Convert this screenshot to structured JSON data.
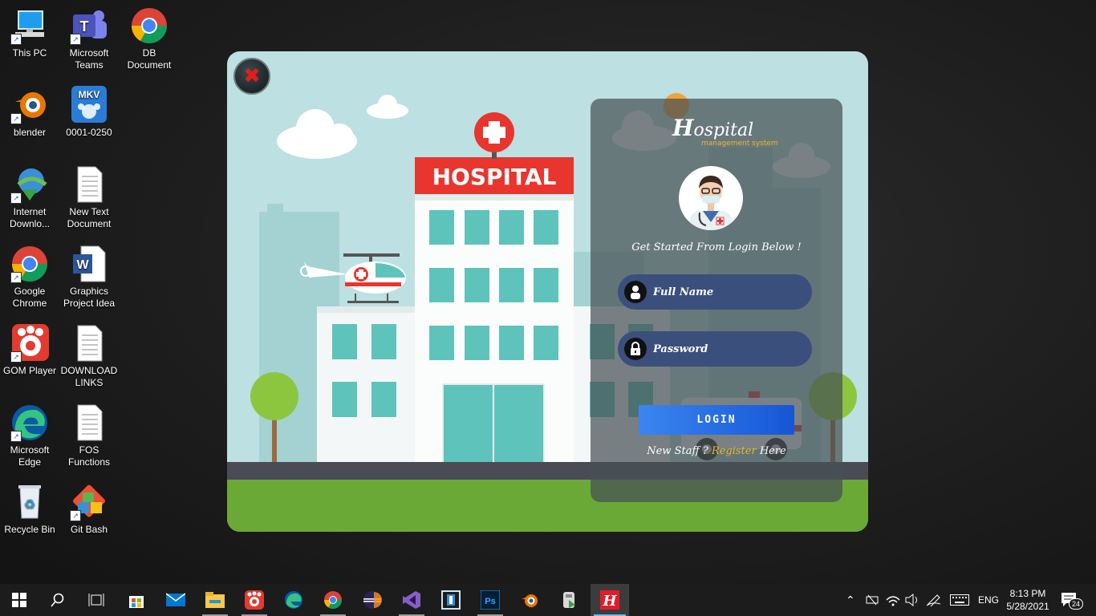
{
  "desktop": {
    "icons": [
      {
        "label": "This PC"
      },
      {
        "label": "Microsoft Teams"
      },
      {
        "label": "DB Document"
      },
      {
        "label": "blender"
      },
      {
        "label": "0001-0250"
      },
      {
        "label": "Internet Downlo..."
      },
      {
        "label": "New Text Document"
      },
      {
        "label": "Google Chrome"
      },
      {
        "label": "Graphics Project Idea"
      },
      {
        "label": "GOM Player"
      },
      {
        "label": "DOWNLOAD LINKS"
      },
      {
        "label": "Microsoft Edge"
      },
      {
        "label": "FOS Functions"
      },
      {
        "label": "Recycle Bin"
      },
      {
        "label": "Git Bash"
      }
    ],
    "mkv_badge": "MKV"
  },
  "app": {
    "scene_sign": "HOSPITAL",
    "brand_letter": "H",
    "brand_rest": "ospital",
    "brand_subtitle": "management system",
    "tagline": "Get Started From Login Below !",
    "fullname_placeholder": "Full Name",
    "password_placeholder": "Password",
    "login_label": "LOGIN",
    "register_prefix": "New Staff ?",
    "register_link": "Register",
    "register_suffix": "Here"
  },
  "taskbar": {
    "pinned": [
      "start-icon",
      "search-icon",
      "task-view-icon",
      "store-icon",
      "mail-icon",
      "file-explorer-icon",
      "gom-icon",
      "edge-icon",
      "chrome-icon",
      "eclipse-icon",
      "visual-studio-icon",
      "app-icon",
      "photoshop-icon",
      "blender-icon",
      "installer-icon",
      "hospital-app-icon"
    ],
    "hospital_app_letter": "H",
    "language": "ENG",
    "time": "8:13 PM",
    "date": "5/28/2021",
    "notifications": "24"
  },
  "colors": {
    "accent_red": "#e8362e",
    "teal": "#5ec3bb",
    "panel": "#4a5256",
    "field": "#3b4f7c",
    "login_blue": "#1e6ae0",
    "gold": "#f0b429"
  }
}
